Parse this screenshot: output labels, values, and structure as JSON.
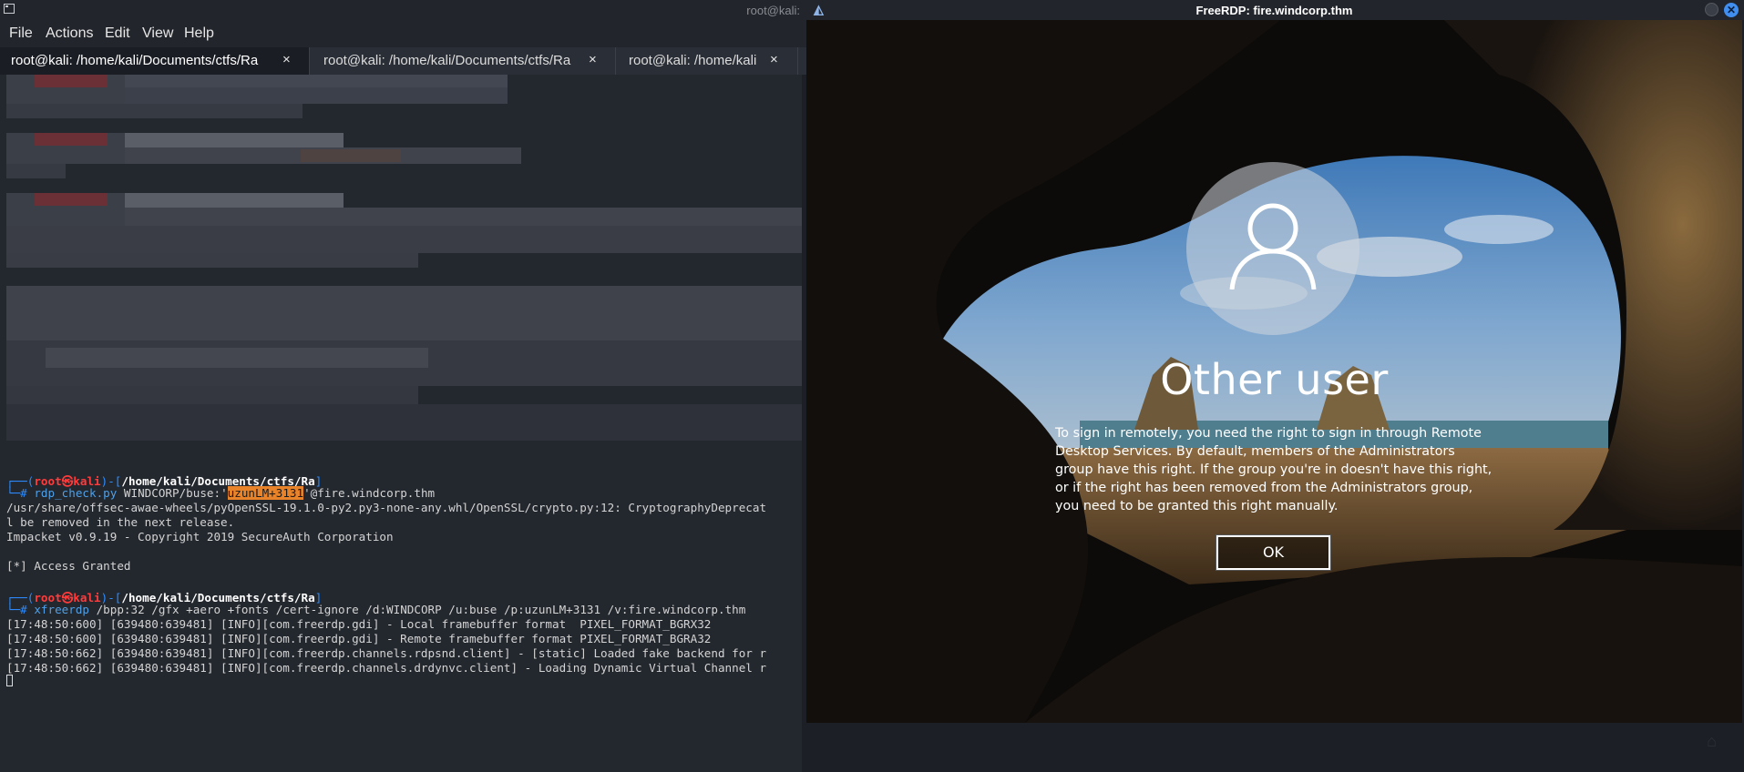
{
  "terminal": {
    "window_title": "root@kali:",
    "menu": [
      "File",
      "Actions",
      "Edit",
      "View",
      "Help"
    ],
    "tabs": [
      {
        "label": "root@kali: /home/kali/Documents/ctfs/Ra",
        "close": "×"
      },
      {
        "label": "root@kali: /home/kali/Documents/ctfs/Ra",
        "close": "×"
      },
      {
        "label": "root@kali: /home/kali",
        "close": "×"
      }
    ],
    "prompt1": {
      "open": "┌──(",
      "user": "root",
      "at": "㉿",
      "host": "kali",
      "mid": ")-[",
      "path": "/home/kali/Documents/ctfs/Ra",
      "close": "]",
      "hash": "└─# "
    },
    "cmd1": {
      "program": "rdp_check.py",
      "args_before": " WINDCORP/buse:'",
      "password": "uzunLM+3131",
      "args_after": "'@fire.windcorp.thm"
    },
    "output1": [
      "/usr/share/offsec-awae-wheels/pyOpenSSL-19.1.0-py2.py3-none-any.whl/OpenSSL/crypto.py:12: CryptographyDeprecat",
      "l be removed in the next release.",
      "Impacket v0.9.19 - Copyright 2019 SecureAuth Corporation",
      "",
      "[*] Access Granted"
    ],
    "cmd2": {
      "program": "xfreerdp",
      "args": " /bpp:32 /gfx +aero +fonts /cert-ignore /d:WINDCORP /u:buse /p:uzunLM+3131 /v:fire.windcorp.thm"
    },
    "output2": [
      "[17:48:50:600] [639480:639481] [INFO][com.freerdp.gdi] - Local framebuffer format  PIXEL_FORMAT_BGRX32",
      "[17:48:50:600] [639480:639481] [INFO][com.freerdp.gdi] - Remote framebuffer format PIXEL_FORMAT_BGRA32",
      "[17:48:50:662] [639480:639481] [INFO][com.freerdp.channels.rdpsnd.client] - [static] Loaded fake backend for r",
      "[17:48:50:662] [639480:639481] [INFO][com.freerdp.channels.drdynvc.client] - Loading Dynamic Virtual Channel r"
    ]
  },
  "rdp": {
    "window_title": "FreeRDP: fire.windcorp.thm",
    "login": {
      "title": "Other user",
      "message": "To sign in remotely, you need the right to sign in through Remote Desktop Services. By default, members of the Administrators group have this right. If the group you're in doesn't have this right, or if the right has been removed from the Administrators group, you need to be granted this right manually.",
      "ok_label": "OK"
    },
    "icons": [
      "freerdp-icon",
      "minimize-icon",
      "close-icon",
      "user-icon"
    ]
  },
  "colors": {
    "prompt_blue": "#2d8cff",
    "prompt_red": "#ff3b3b",
    "password_highlight": "#e8832a",
    "terminal_bg": "#23272e",
    "close_button": "#3f8ef0"
  }
}
